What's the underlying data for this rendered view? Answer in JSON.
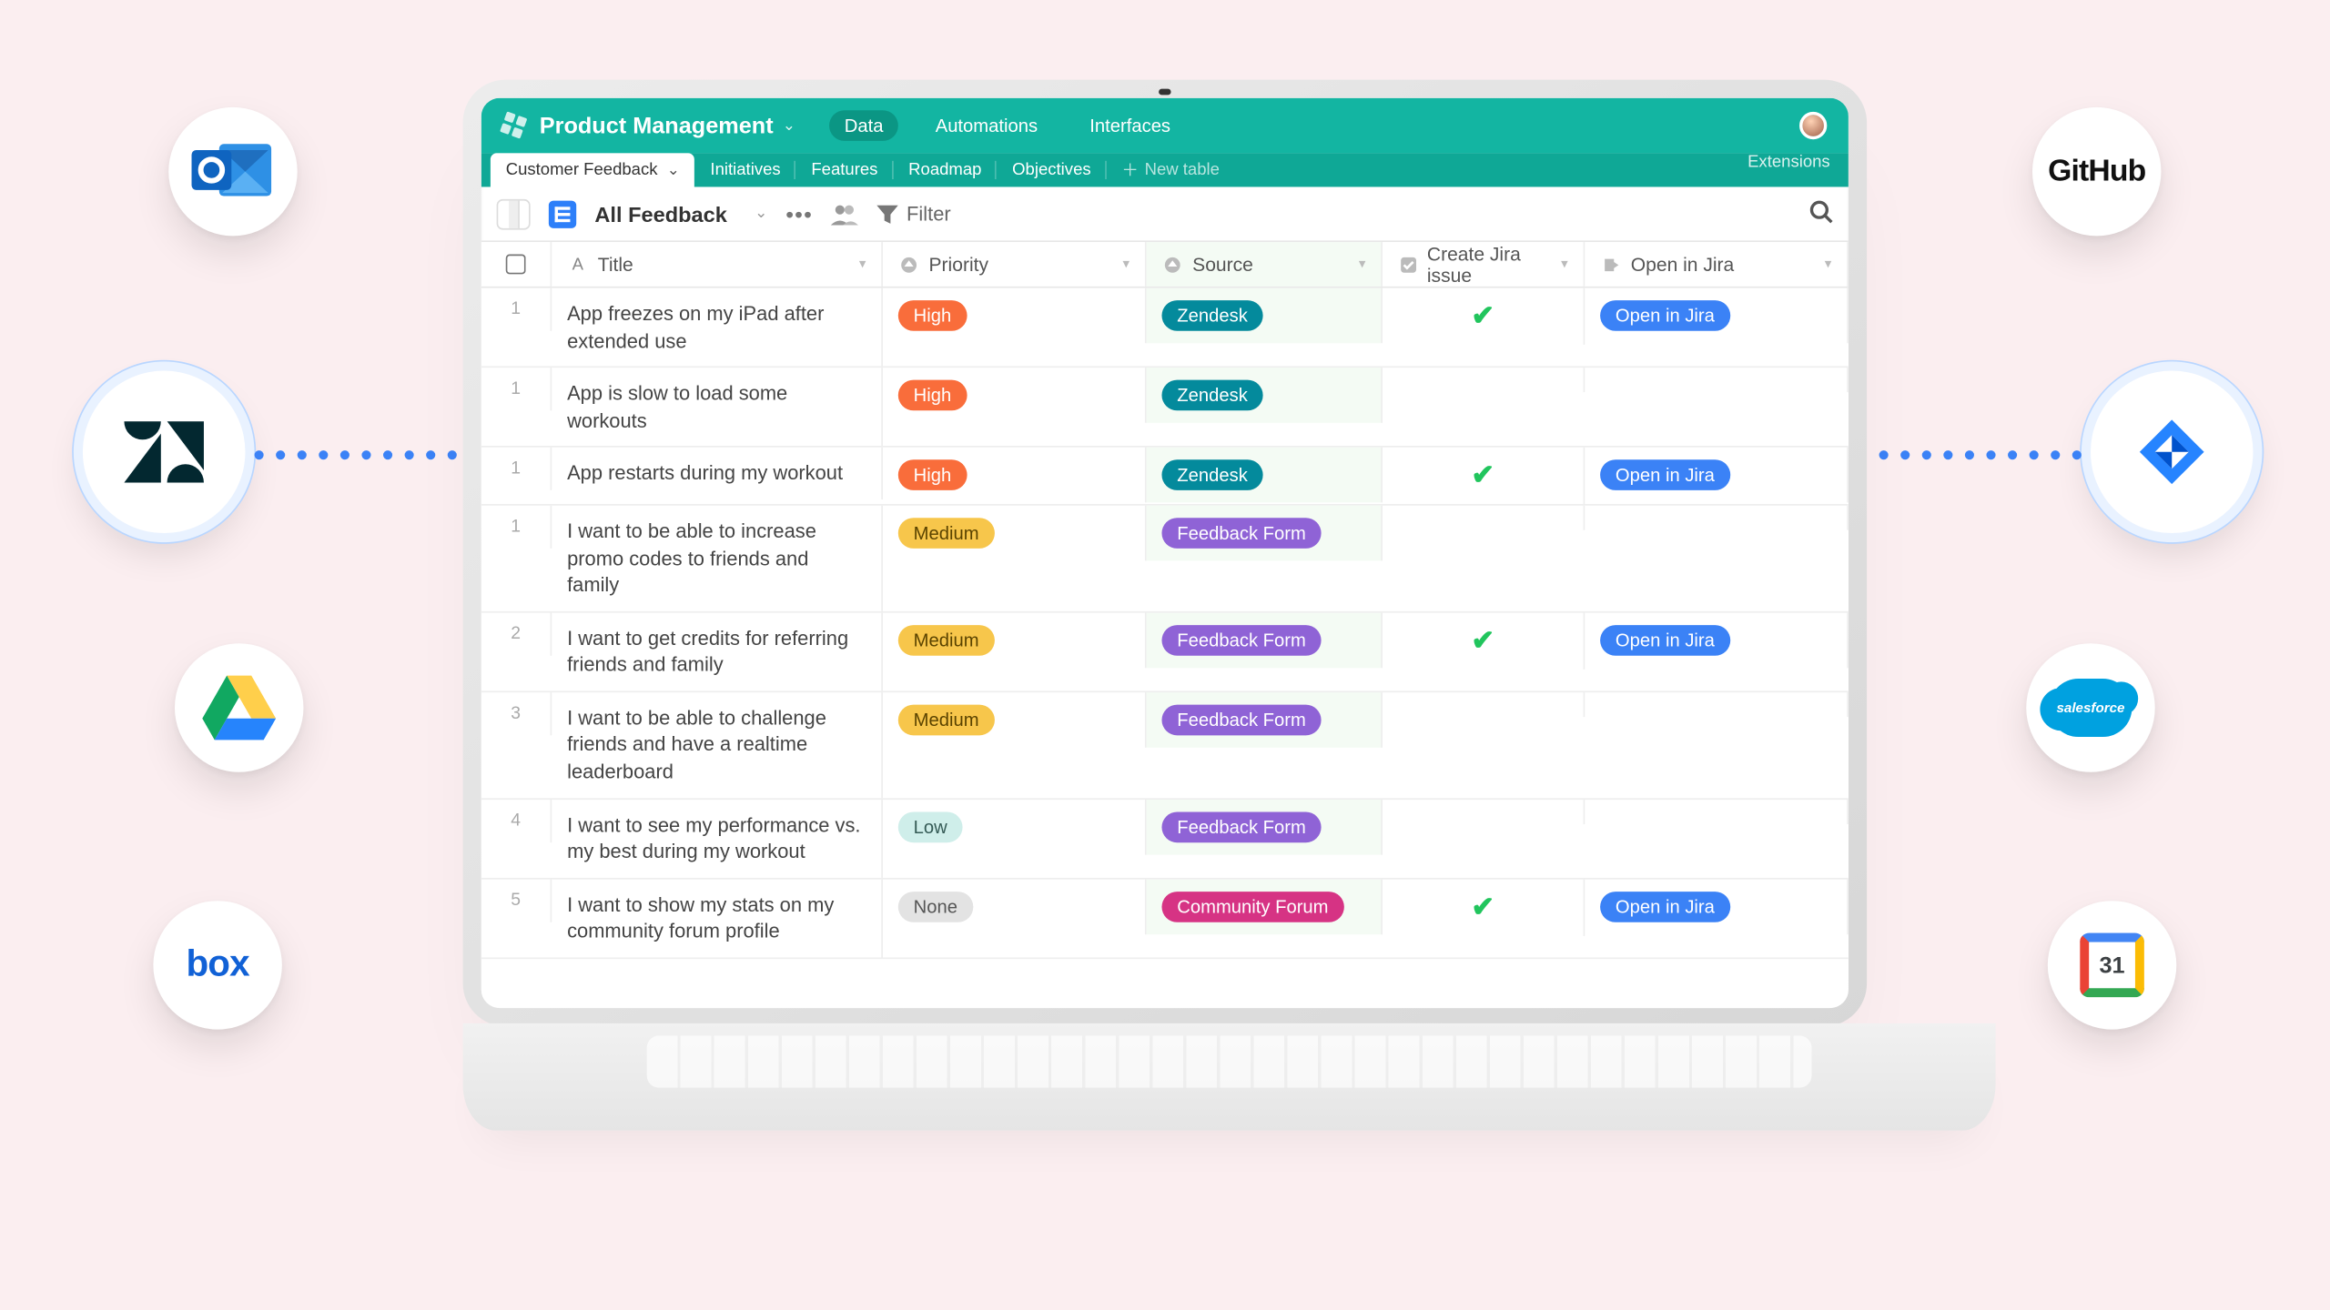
{
  "header": {
    "base_name": "Product Management",
    "nav": {
      "data": "Data",
      "automations": "Automations",
      "interfaces": "Interfaces"
    }
  },
  "tabs": {
    "customer_feedback": "Customer Feedback",
    "initiatives": "Initiatives",
    "features": "Features",
    "roadmap": "Roadmap",
    "objectives": "Objectives",
    "new_table": "New table",
    "extensions": "Extensions"
  },
  "viewbar": {
    "view_name": "All Feedback",
    "filter_label": "Filter"
  },
  "columns": {
    "title": "Title",
    "priority": "Priority",
    "source": "Source",
    "create_jira": "Create Jira issue",
    "open_jira": "Open in Jira"
  },
  "priority_labels": {
    "high": "High",
    "medium": "Medium",
    "low": "Low",
    "none": "None"
  },
  "source_labels": {
    "zendesk": "Zendesk",
    "form": "Feedback Form",
    "forum": "Community Forum"
  },
  "jira_open_label": "Open in Jira",
  "rows": [
    {
      "n": "1",
      "title": "App freezes on my iPad after extended use",
      "priority": "high",
      "source": "zendesk",
      "jira": true,
      "open": true
    },
    {
      "n": "1",
      "title": "App is slow to load some workouts",
      "priority": "high",
      "source": "zendesk",
      "jira": false,
      "open": false
    },
    {
      "n": "1",
      "title": "App restarts during my workout",
      "priority": "high",
      "source": "zendesk",
      "jira": true,
      "open": true
    },
    {
      "n": "1",
      "title": "I want to be able to increase promo codes to friends and family",
      "priority": "medium",
      "source": "form",
      "jira": false,
      "open": false
    },
    {
      "n": "2",
      "title": "I want to get credits for referring friends and family",
      "priority": "medium",
      "source": "form",
      "jira": true,
      "open": true
    },
    {
      "n": "3",
      "title": "I want to be able to challenge friends and have a realtime leaderboard",
      "priority": "medium",
      "source": "form",
      "jira": false,
      "open": false
    },
    {
      "n": "4",
      "title": "I want to see my performance vs. my best during my workout",
      "priority": "low",
      "source": "form",
      "jira": false,
      "open": false
    },
    {
      "n": "5",
      "title": "I want to show my stats on my community forum profile",
      "priority": "none",
      "source": "forum",
      "jira": true,
      "open": true
    }
  ],
  "integrations": {
    "outlook": "Outlook",
    "zendesk": "Zendesk",
    "gdrive": "Google Drive",
    "box": "Box",
    "github": "GitHub",
    "jira": "Jira",
    "salesforce": "salesforce",
    "gcal": "Google Calendar",
    "gcal_day": "31"
  }
}
